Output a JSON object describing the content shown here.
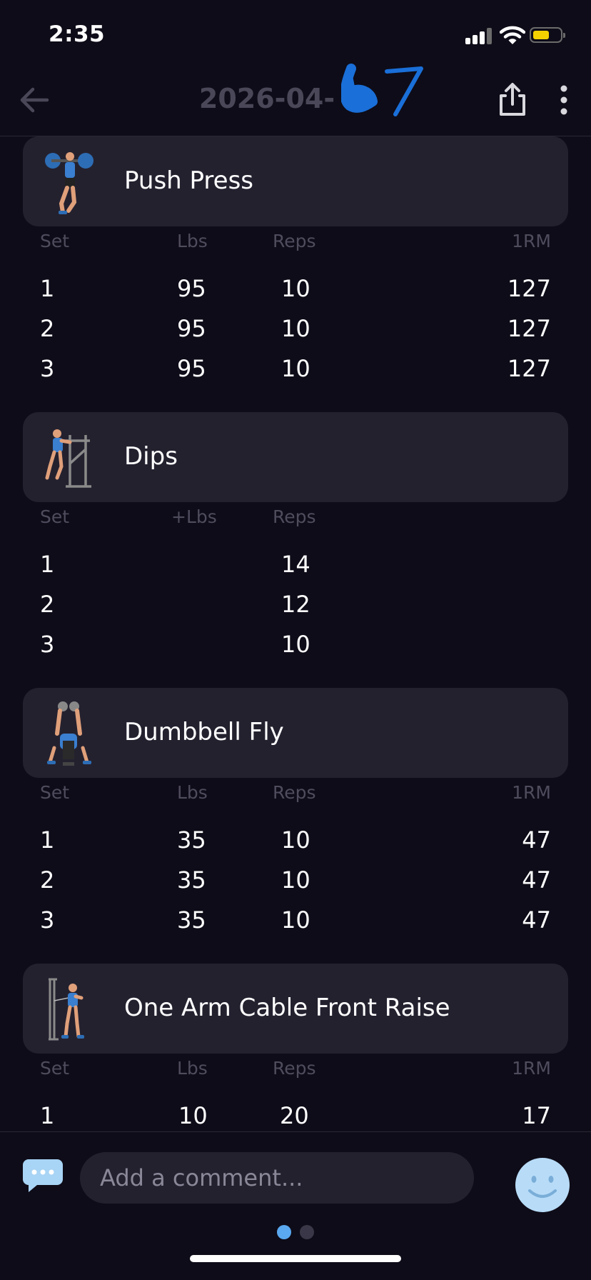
{
  "status": {
    "time": "2:35"
  },
  "nav": {
    "title": "2026-04-"
  },
  "exercises": [
    {
      "name": "Push Press",
      "icon": "push-press-figure-icon",
      "headers": {
        "set": "Set",
        "lbs": "Lbs",
        "reps": "Reps",
        "orm": "1RM"
      },
      "sets": [
        {
          "set": "1",
          "lbs": "95",
          "reps": "10",
          "orm": "127"
        },
        {
          "set": "2",
          "lbs": "95",
          "reps": "10",
          "orm": "127"
        },
        {
          "set": "3",
          "lbs": "95",
          "reps": "10",
          "orm": "127"
        }
      ]
    },
    {
      "name": "Dips",
      "icon": "dips-figure-icon",
      "headers": {
        "set": "Set",
        "lbs": "+Lbs",
        "reps": "Reps",
        "orm": ""
      },
      "sets": [
        {
          "set": "1",
          "lbs": "",
          "reps": "14",
          "orm": ""
        },
        {
          "set": "2",
          "lbs": "",
          "reps": "12",
          "orm": ""
        },
        {
          "set": "3",
          "lbs": "",
          "reps": "10",
          "orm": ""
        }
      ]
    },
    {
      "name": "Dumbbell Fly",
      "icon": "dumbbell-fly-figure-icon",
      "headers": {
        "set": "Set",
        "lbs": "Lbs",
        "reps": "Reps",
        "orm": "1RM"
      },
      "sets": [
        {
          "set": "1",
          "lbs": "35",
          "reps": "10",
          "orm": "47"
        },
        {
          "set": "2",
          "lbs": "35",
          "reps": "10",
          "orm": "47"
        },
        {
          "set": "3",
          "lbs": "35",
          "reps": "10",
          "orm": "47"
        }
      ]
    },
    {
      "name": "One Arm Cable Front Raise",
      "icon": "cable-front-raise-figure-icon",
      "headers": {
        "set": "Set",
        "lbs": "Lbs",
        "reps": "Reps",
        "orm": "1RM"
      },
      "sets": [
        {
          "set": "1",
          "lbs": "10",
          "reps": "20",
          "orm": "17"
        }
      ]
    }
  ],
  "comment": {
    "placeholder": "Add a comment..."
  },
  "colors": {
    "accent": "#5aa8f0",
    "dot_inactive": "#3a3848",
    "card": "#24212f",
    "background": "#0e0c18",
    "scribble": "#1a6fd8"
  }
}
